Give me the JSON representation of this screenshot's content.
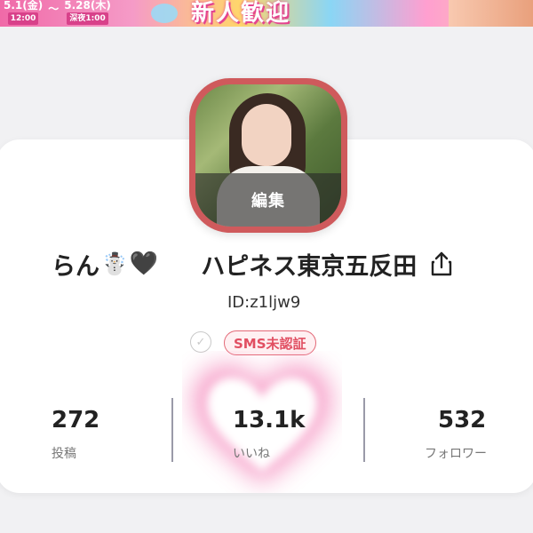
{
  "banner": {
    "start_date": "5.1(金)",
    "start_time": "12:00",
    "separator": "〜",
    "end_date": "5.28(木)",
    "end_time": "深夜1:00",
    "event_text": "新人歓迎"
  },
  "profile": {
    "name": "らん",
    "name_emoji_1": "☃️",
    "name_emoji_2": "🖤",
    "shop_name": "ハピネス東京五反田",
    "user_id": "ID:z1ljw9",
    "edit_label": "編集",
    "sms_status": "SMS未認証"
  },
  "stats": [
    {
      "value": "272",
      "label": "投稿"
    },
    {
      "value": "13.1k",
      "label": "いいね"
    },
    {
      "value": "532",
      "label": "フォロワー"
    }
  ],
  "colors": {
    "accent": "#e14f62",
    "avatar_border": "#cf5a5c",
    "card_bg": "#ffffff",
    "page_bg": "#f1f1f3"
  },
  "icons": {
    "share": "share-icon",
    "check": "check-circle-icon",
    "heart": "glow-heart-icon"
  }
}
